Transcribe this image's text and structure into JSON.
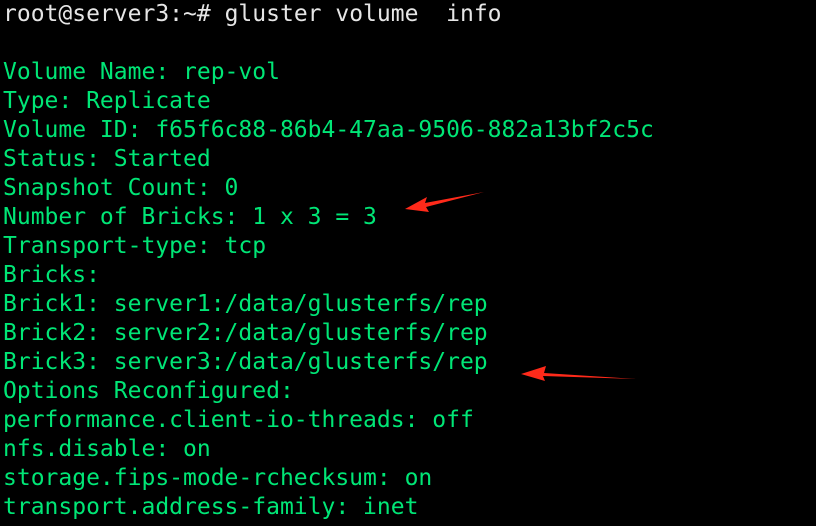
{
  "prompt": {
    "user_host_path": "root@server3:~#",
    "command": "gluster volume  info"
  },
  "output_lines": [
    "Volume Name: rep-vol",
    "Type: Replicate",
    "Volume ID: f65f6c88-86b4-47aa-9506-882a13bf2c5c",
    "Status: Started",
    "Snapshot Count: 0",
    "Number of Bricks: 1 x 3 = 3",
    "Transport-type: tcp",
    "Bricks:",
    "Brick1: server1:/data/glusterfs/rep",
    "Brick2: server2:/data/glusterfs/rep",
    "Brick3: server3:/data/glusterfs/rep",
    "Options Reconfigured:",
    "performance.client-io-threads: off",
    "nfs.disable: on",
    "storage.fips-mode-rchecksum: on",
    "transport.address-family: inet"
  ],
  "colors": {
    "background": "#000000",
    "output_text": "#00e676",
    "prompt_text": "#e6e6e6",
    "annotation_arrow": "#ff2a1a"
  },
  "annotations": {
    "arrow_1_icon": "red-arrow-icon",
    "arrow_2_icon": "red-arrow-icon"
  }
}
